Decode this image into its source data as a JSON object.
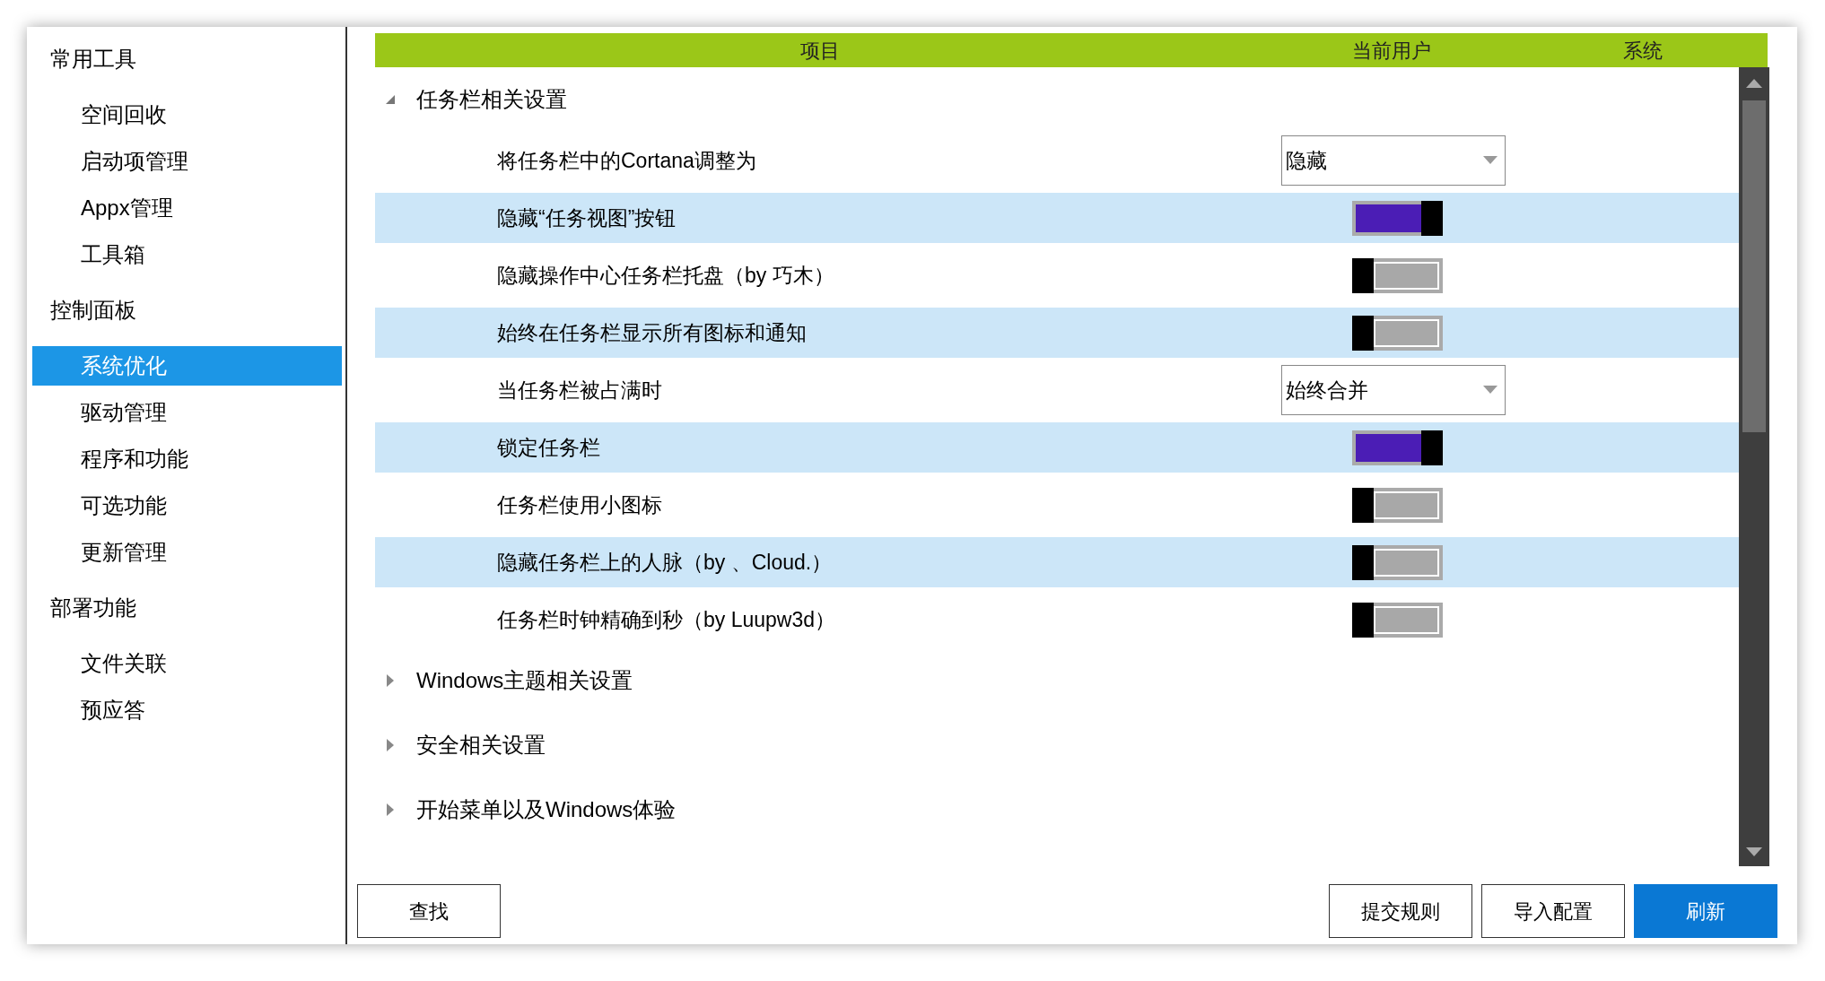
{
  "sidebar": {
    "sections": [
      {
        "title": "常用工具",
        "items": [
          {
            "label": "空间回收",
            "selected": false
          },
          {
            "label": "启动项管理",
            "selected": false
          },
          {
            "label": "Appx管理",
            "selected": false
          },
          {
            "label": "工具箱",
            "selected": false
          }
        ]
      },
      {
        "title": "控制面板",
        "items": [
          {
            "label": "系统优化",
            "selected": true
          },
          {
            "label": "驱动管理",
            "selected": false
          },
          {
            "label": "程序和功能",
            "selected": false
          },
          {
            "label": "可选功能",
            "selected": false
          },
          {
            "label": "更新管理",
            "selected": false
          }
        ]
      },
      {
        "title": "部署功能",
        "items": [
          {
            "label": "文件关联",
            "selected": false
          },
          {
            "label": "预应答",
            "selected": false
          }
        ]
      }
    ]
  },
  "table": {
    "columns": [
      "项目",
      "当前用户",
      "系统"
    ],
    "groups": [
      {
        "label": "任务栏相关设置",
        "expanded": true,
        "children": [
          {
            "kind": "dropdown",
            "label": "将任务栏中的Cortana调整为",
            "value": "隐藏"
          },
          {
            "kind": "toggle",
            "label": "隐藏“任务视图”按钮",
            "on": true
          },
          {
            "kind": "toggle",
            "label": "隐藏操作中心任务栏托盘（by 巧木）",
            "on": false
          },
          {
            "kind": "toggle",
            "label": "始终在任务栏显示所有图标和通知",
            "on": false
          },
          {
            "kind": "dropdown",
            "label": "当任务栏被占满时",
            "value": "始终合并"
          },
          {
            "kind": "toggle",
            "label": "锁定任务栏",
            "on": true
          },
          {
            "kind": "toggle",
            "label": "任务栏使用小图标",
            "on": false
          },
          {
            "kind": "toggle",
            "label": "隐藏任务栏上的人脉（by 、Cloud.）",
            "on": false
          },
          {
            "kind": "toggle",
            "label": "任务栏时钟精确到秒（by Luupw3d）",
            "on": false
          }
        ]
      },
      {
        "label": "Windows主题相关设置",
        "expanded": false
      },
      {
        "label": "安全相关设置",
        "expanded": false
      },
      {
        "label": "开始菜单以及Windows体验",
        "expanded": false
      }
    ]
  },
  "buttons": {
    "left": [
      {
        "label": "查找",
        "primary": false
      }
    ],
    "right": [
      {
        "label": "提交规则",
        "primary": false
      },
      {
        "label": "导入配置",
        "primary": false
      },
      {
        "label": "刷新",
        "primary": true
      }
    ]
  }
}
